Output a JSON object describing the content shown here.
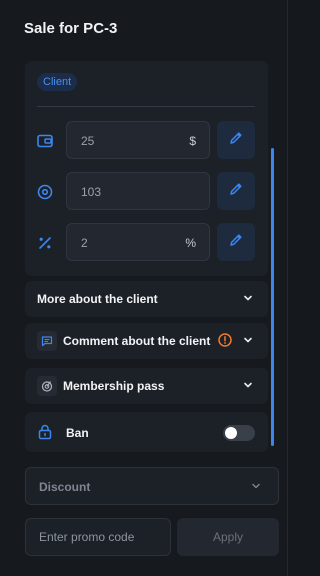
{
  "title": "Sale for PC-3",
  "client_card": {
    "badge": "Client",
    "rows": [
      {
        "icon": "wallet-icon",
        "value": "25",
        "unit": "$"
      },
      {
        "icon": "target-icon",
        "value": "103",
        "unit": ""
      },
      {
        "icon": "percent-icon",
        "value": "2",
        "unit": "%"
      }
    ]
  },
  "sections": {
    "more": {
      "label": "More about the client"
    },
    "comment": {
      "label": "Comment about the client",
      "alert_icon": "alert-circle-icon"
    },
    "membership": {
      "label": "Membership pass"
    },
    "ban": {
      "label": "Ban",
      "toggle_on": false
    }
  },
  "discount": {
    "label": "Discount"
  },
  "promo": {
    "placeholder": "Enter promo code",
    "apply_label": "Apply"
  },
  "colors": {
    "accent": "#3d86ee",
    "warning": "#f07a2e",
    "background": "#16191e",
    "card": "#1c2027"
  }
}
